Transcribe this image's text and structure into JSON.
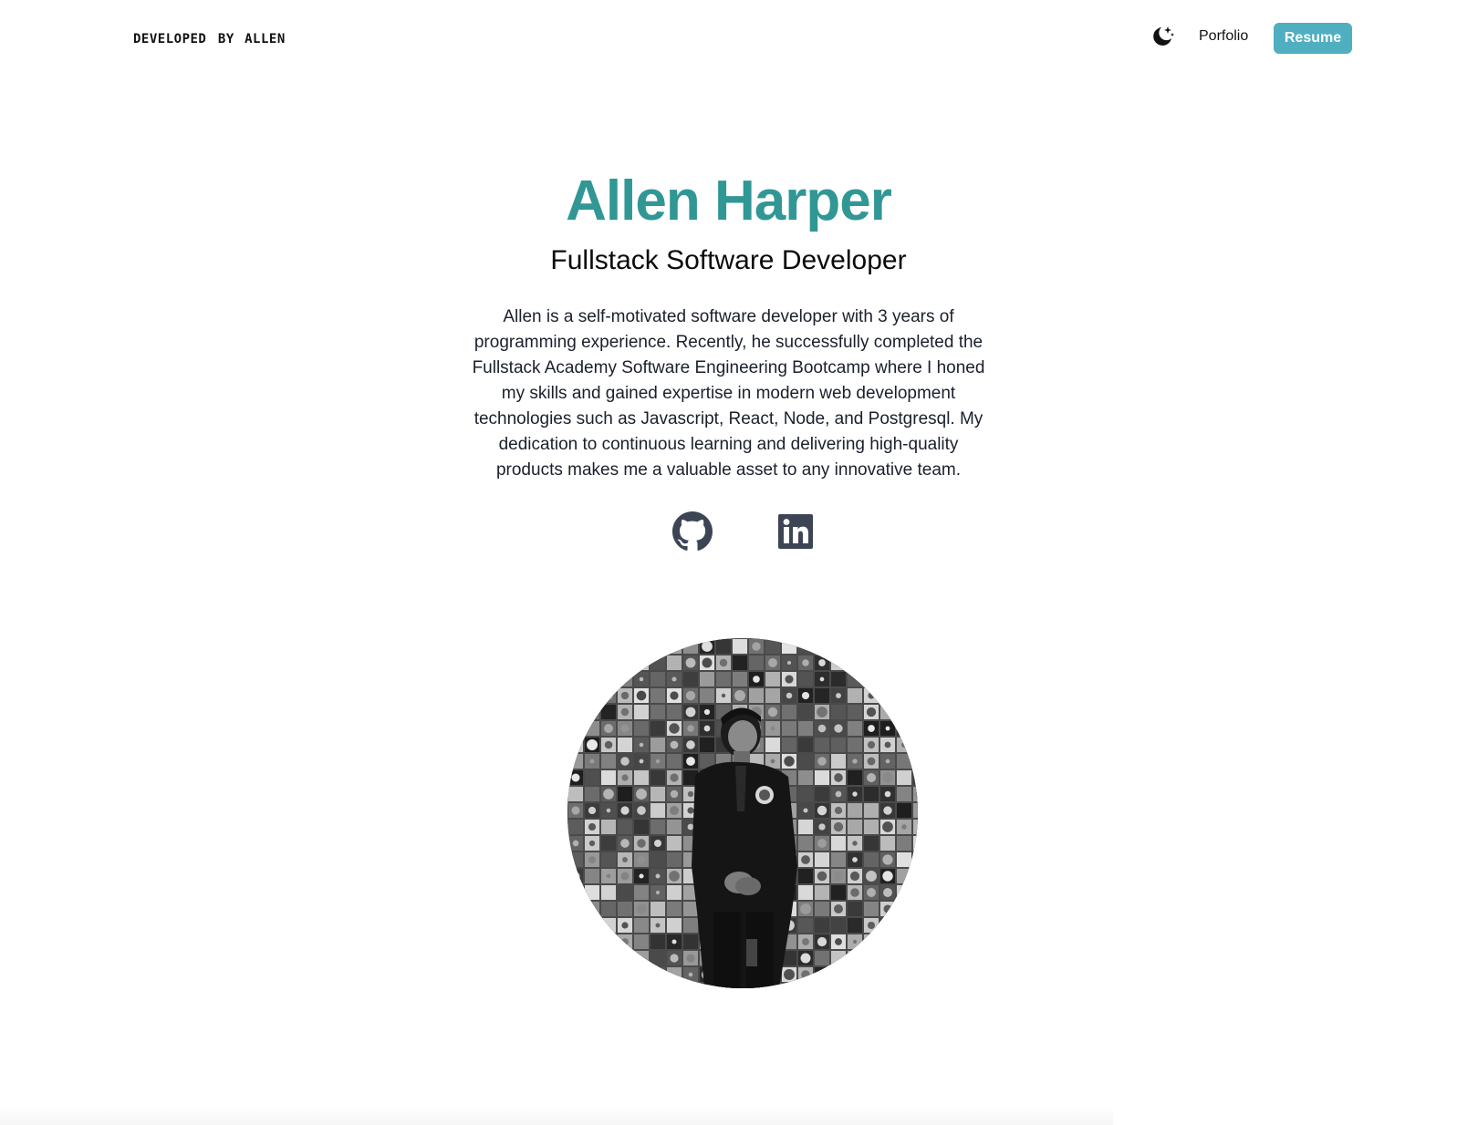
{
  "header": {
    "brand_prefix": "developed by",
    "brand_name": "Allen",
    "theme_icon": "moon-stars-icon",
    "nav_link": "Porfolio",
    "resume_label": "Resume"
  },
  "hero": {
    "name": "Allen Harper",
    "title": "Fullstack Software Developer",
    "bio": "Allen is a self-motivated software developer with 3 years of programming experience. Recently, he successfully completed the Fullstack Academy Software Engineering Bootcamp where I honed my skills and gained expertise in modern web development technologies such as Javascript, React, Node, and Postgresql. My dedication to continuous learning and delivering high-quality products makes me a valuable asset to any innovative team."
  },
  "socials": [
    {
      "icon": "github-icon"
    },
    {
      "icon": "linkedin-icon"
    }
  ],
  "colors": {
    "accent": "#319795",
    "button": "#4fafc0",
    "icon": "#3d4454"
  }
}
